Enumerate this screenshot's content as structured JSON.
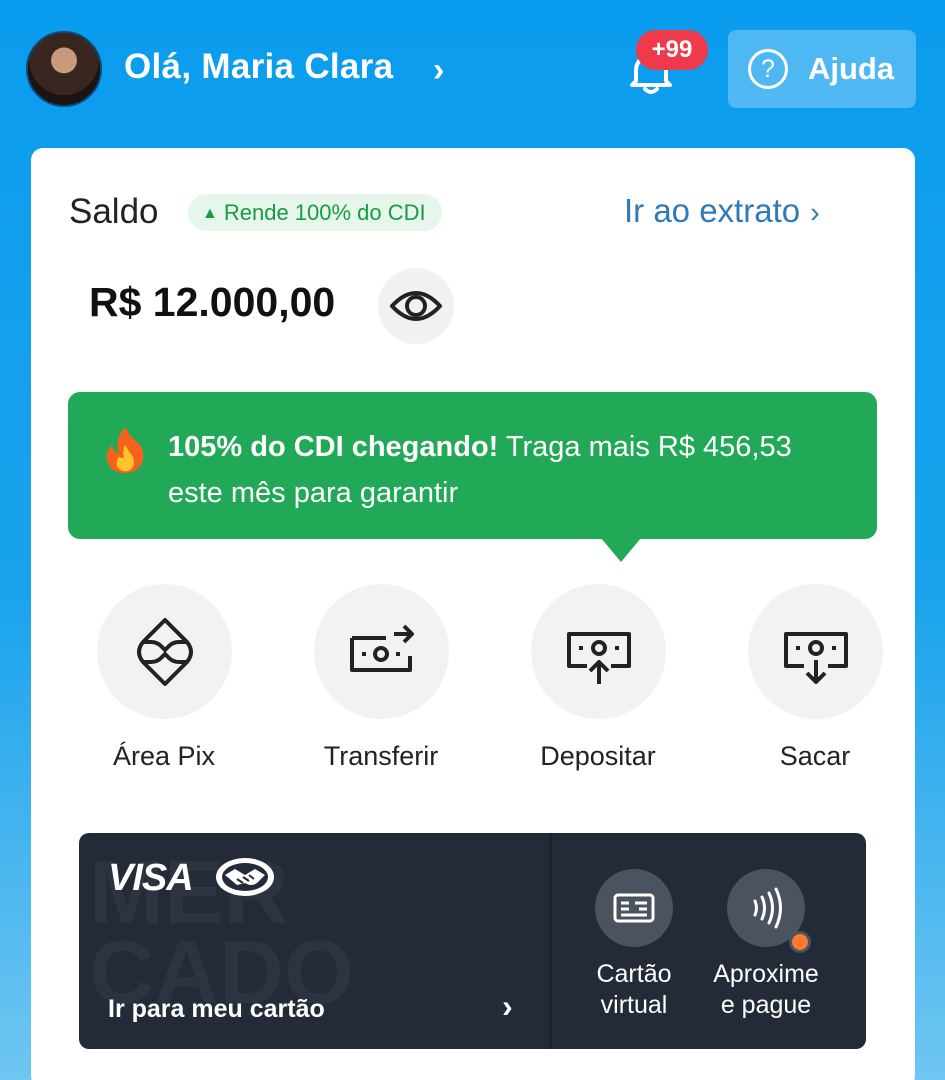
{
  "header": {
    "greeting": "Olá, Maria Clara",
    "chevron": "›",
    "notifications_badge": "+99",
    "help_label": "Ajuda",
    "help_icon": "?"
  },
  "balance_card": {
    "saldo_label": "Saldo",
    "cdi_pill": "Rende 100% do CDI",
    "cdi_pill_icon": "▲",
    "extrato_link": "Ir ao extrato",
    "extrato_chevron": "›",
    "balance": "R$ 12.000,00"
  },
  "promo": {
    "bold_text": "105% do CDI chegando!",
    "rest_text": " Traga mais R$ 456,53 este mês para garantir"
  },
  "actions": [
    {
      "label": "Área Pix",
      "icon": "pix-icon"
    },
    {
      "label": "Transferir",
      "icon": "transfer-icon"
    },
    {
      "label": "Depositar",
      "icon": "deposit-icon"
    },
    {
      "label": "Sacar",
      "icon": "withdraw-icon"
    }
  ],
  "credit_card": {
    "brand": "VISA",
    "watermark": "MER\nCADO",
    "go_label": "Ir para meu cartão",
    "go_chevron": "›",
    "virtual_label_1": "Cartão",
    "virtual_label_2": "virtual",
    "contactless_label_1": "Aproxime",
    "contactless_label_2": "e pague"
  },
  "colors": {
    "accent_blue": "#0a9cee",
    "promo_green": "#21a957",
    "badge_red": "#ee3a4a",
    "link_blue": "#2f7ab8",
    "card_dark": "#232b38",
    "dot_orange": "#ff7a2f"
  }
}
